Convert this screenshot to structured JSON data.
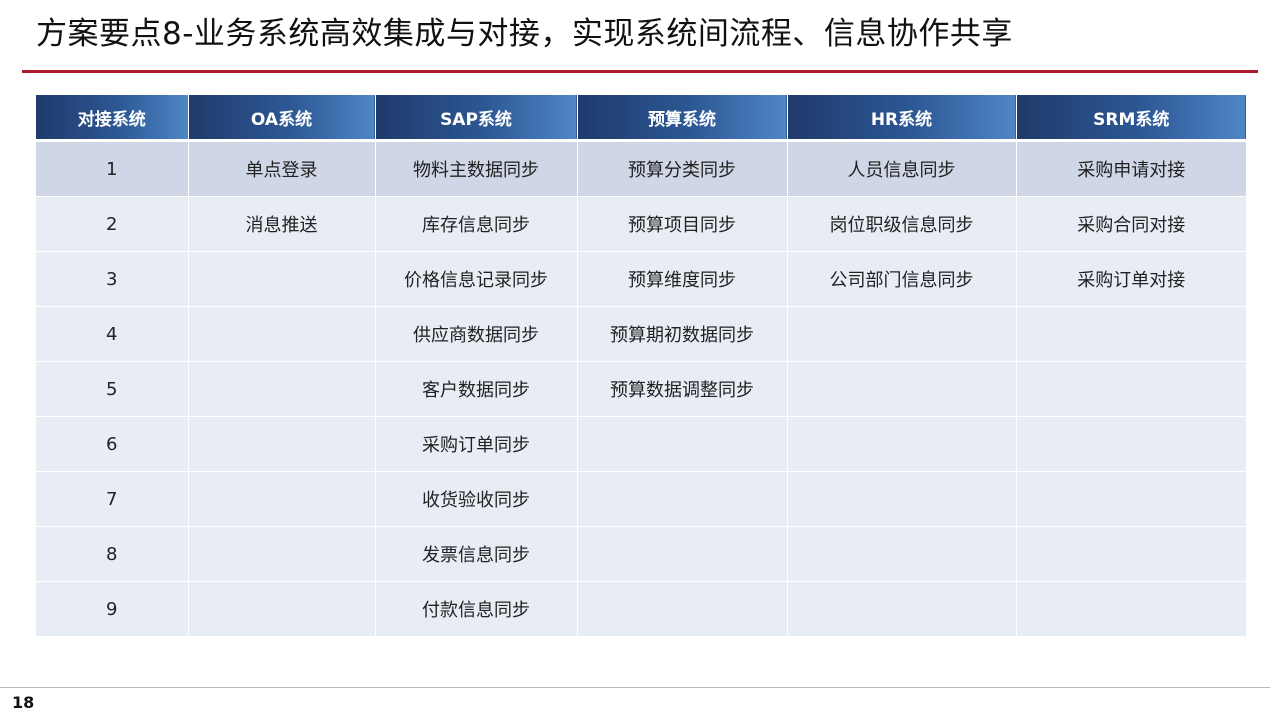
{
  "slide": {
    "title": "方案要点8-业务系统高效集成与对接，实现系统间流程、信息协作共享",
    "page_number": "18"
  },
  "table": {
    "headers": [
      "对接系统",
      "OA系统",
      "SAP系统",
      "预算系统",
      "HR系统",
      "SRM系统"
    ],
    "rows": [
      [
        "1",
        "单点登录",
        "物料主数据同步",
        "预算分类同步",
        "人员信息同步",
        "采购申请对接"
      ],
      [
        "2",
        "消息推送",
        "库存信息同步",
        "预算项目同步",
        "岗位职级信息同步",
        "采购合同对接"
      ],
      [
        "3",
        "",
        "价格信息记录同步",
        "预算维度同步",
        "公司部门信息同步",
        "采购订单对接"
      ],
      [
        "4",
        "",
        "供应商数据同步",
        "预算期初数据同步",
        "",
        ""
      ],
      [
        "5",
        "",
        "客户数据同步",
        "预算数据调整同步",
        "",
        ""
      ],
      [
        "6",
        "",
        "采购订单同步",
        "",
        "",
        ""
      ],
      [
        "7",
        "",
        "收货验收同步",
        "",
        "",
        ""
      ],
      [
        "8",
        "",
        "发票信息同步",
        "",
        "",
        ""
      ],
      [
        "9",
        "",
        "付款信息同步",
        "",
        "",
        ""
      ]
    ]
  },
  "colors": {
    "accent_rule": "#b01b2e",
    "header_dark": "#1f3a6b",
    "header_light": "#4f86c6",
    "row_first": "#cfd6e6",
    "row_other": "#e8ecf4"
  }
}
